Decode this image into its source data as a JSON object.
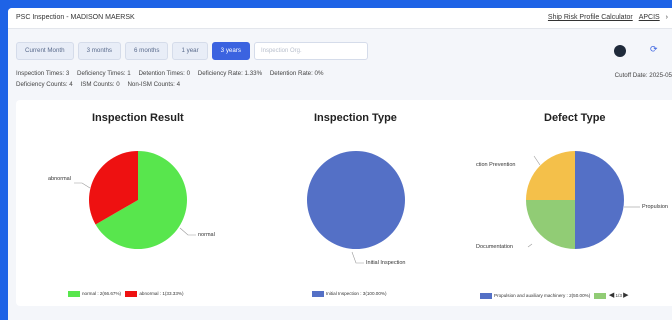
{
  "titlebar": {
    "title": "PSC Inspection",
    "separator": "-",
    "vessel": "MADISON MAERSK",
    "link_calculator": "Ship Risk Profile Calculator",
    "link_apcis": "APCIS",
    "chevron": "›"
  },
  "filters": {
    "periods": [
      "Current Month",
      "3 months",
      "6 months",
      "1 year",
      "3 years"
    ],
    "active": "3 years",
    "search_placeholder": "Inspection Org."
  },
  "stats": {
    "inspection_times": "Inspection Times:  3",
    "deficiency_times": "Deficiency Times:  1",
    "detention_times": "Detention Times:  0",
    "deficiency_rate": "Deficiency Rate:  1.33%",
    "detention_rate": "Detention Rate:  0%",
    "deficiency_counts": "Deficiency Counts:  4",
    "ism_counts": "ISM Counts:  0",
    "non_ism_counts": "Non-ISM Counts:  4",
    "cutoff": "Cutoff Date: 2025-05"
  },
  "colors": {
    "green": "#58e64d",
    "red": "#ee1111",
    "blue": "#5470c6",
    "yellow": "#f4c04a",
    "lightgreen": "#91cc75",
    "accent": "#3b63e0"
  },
  "charts": {
    "result": {
      "title": "Inspection Result",
      "label_abnormal": "abnormal",
      "label_normal": "normal",
      "legend_normal": "normal : 2(66.67%)",
      "legend_abnormal": "abnormal : 1(33.33%)"
    },
    "type": {
      "title": "Inspection Type",
      "label_initial": "Initial Inspection",
      "legend_initial": "Initial Inspection : 3(100.00%)"
    },
    "defect": {
      "title": "Defect Type",
      "label_fire": "ction Prevention",
      "label_propulsion": "Propulsion",
      "label_doc": "Documentation",
      "legend_propulsion": "Propulsion and auxiliary machinery : 2(50.00%)",
      "pager": "1/3"
    }
  },
  "chart_data": [
    {
      "type": "pie",
      "title": "Inspection Result",
      "labels": [
        "normal",
        "abnormal"
      ],
      "values": [
        2,
        1
      ]
    },
    {
      "type": "pie",
      "title": "Inspection Type",
      "labels": [
        "Initial Inspection"
      ],
      "values": [
        3
      ]
    },
    {
      "type": "pie",
      "title": "Defect Type",
      "labels": [
        "Propulsion",
        "Documentation",
        "ction Prevention"
      ],
      "values": [
        2,
        1,
        1
      ]
    }
  ]
}
